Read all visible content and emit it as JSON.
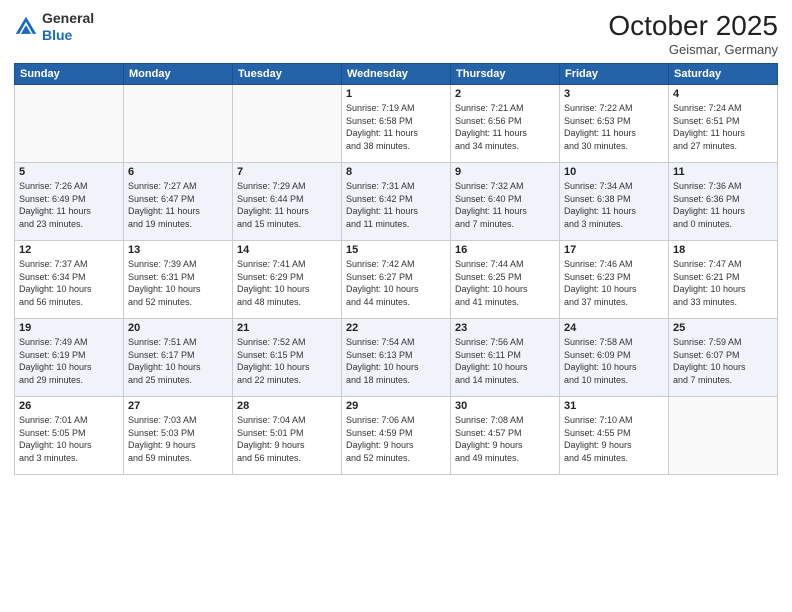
{
  "header": {
    "logo_general": "General",
    "logo_blue": "Blue",
    "month_title": "October 2025",
    "location": "Geismar, Germany"
  },
  "weekdays": [
    "Sunday",
    "Monday",
    "Tuesday",
    "Wednesday",
    "Thursday",
    "Friday",
    "Saturday"
  ],
  "weeks": [
    [
      {
        "day": "",
        "info": ""
      },
      {
        "day": "",
        "info": ""
      },
      {
        "day": "",
        "info": ""
      },
      {
        "day": "1",
        "info": "Sunrise: 7:19 AM\nSunset: 6:58 PM\nDaylight: 11 hours\nand 38 minutes."
      },
      {
        "day": "2",
        "info": "Sunrise: 7:21 AM\nSunset: 6:56 PM\nDaylight: 11 hours\nand 34 minutes."
      },
      {
        "day": "3",
        "info": "Sunrise: 7:22 AM\nSunset: 6:53 PM\nDaylight: 11 hours\nand 30 minutes."
      },
      {
        "day": "4",
        "info": "Sunrise: 7:24 AM\nSunset: 6:51 PM\nDaylight: 11 hours\nand 27 minutes."
      }
    ],
    [
      {
        "day": "5",
        "info": "Sunrise: 7:26 AM\nSunset: 6:49 PM\nDaylight: 11 hours\nand 23 minutes."
      },
      {
        "day": "6",
        "info": "Sunrise: 7:27 AM\nSunset: 6:47 PM\nDaylight: 11 hours\nand 19 minutes."
      },
      {
        "day": "7",
        "info": "Sunrise: 7:29 AM\nSunset: 6:44 PM\nDaylight: 11 hours\nand 15 minutes."
      },
      {
        "day": "8",
        "info": "Sunrise: 7:31 AM\nSunset: 6:42 PM\nDaylight: 11 hours\nand 11 minutes."
      },
      {
        "day": "9",
        "info": "Sunrise: 7:32 AM\nSunset: 6:40 PM\nDaylight: 11 hours\nand 7 minutes."
      },
      {
        "day": "10",
        "info": "Sunrise: 7:34 AM\nSunset: 6:38 PM\nDaylight: 11 hours\nand 3 minutes."
      },
      {
        "day": "11",
        "info": "Sunrise: 7:36 AM\nSunset: 6:36 PM\nDaylight: 11 hours\nand 0 minutes."
      }
    ],
    [
      {
        "day": "12",
        "info": "Sunrise: 7:37 AM\nSunset: 6:34 PM\nDaylight: 10 hours\nand 56 minutes."
      },
      {
        "day": "13",
        "info": "Sunrise: 7:39 AM\nSunset: 6:31 PM\nDaylight: 10 hours\nand 52 minutes."
      },
      {
        "day": "14",
        "info": "Sunrise: 7:41 AM\nSunset: 6:29 PM\nDaylight: 10 hours\nand 48 minutes."
      },
      {
        "day": "15",
        "info": "Sunrise: 7:42 AM\nSunset: 6:27 PM\nDaylight: 10 hours\nand 44 minutes."
      },
      {
        "day": "16",
        "info": "Sunrise: 7:44 AM\nSunset: 6:25 PM\nDaylight: 10 hours\nand 41 minutes."
      },
      {
        "day": "17",
        "info": "Sunrise: 7:46 AM\nSunset: 6:23 PM\nDaylight: 10 hours\nand 37 minutes."
      },
      {
        "day": "18",
        "info": "Sunrise: 7:47 AM\nSunset: 6:21 PM\nDaylight: 10 hours\nand 33 minutes."
      }
    ],
    [
      {
        "day": "19",
        "info": "Sunrise: 7:49 AM\nSunset: 6:19 PM\nDaylight: 10 hours\nand 29 minutes."
      },
      {
        "day": "20",
        "info": "Sunrise: 7:51 AM\nSunset: 6:17 PM\nDaylight: 10 hours\nand 25 minutes."
      },
      {
        "day": "21",
        "info": "Sunrise: 7:52 AM\nSunset: 6:15 PM\nDaylight: 10 hours\nand 22 minutes."
      },
      {
        "day": "22",
        "info": "Sunrise: 7:54 AM\nSunset: 6:13 PM\nDaylight: 10 hours\nand 18 minutes."
      },
      {
        "day": "23",
        "info": "Sunrise: 7:56 AM\nSunset: 6:11 PM\nDaylight: 10 hours\nand 14 minutes."
      },
      {
        "day": "24",
        "info": "Sunrise: 7:58 AM\nSunset: 6:09 PM\nDaylight: 10 hours\nand 10 minutes."
      },
      {
        "day": "25",
        "info": "Sunrise: 7:59 AM\nSunset: 6:07 PM\nDaylight: 10 hours\nand 7 minutes."
      }
    ],
    [
      {
        "day": "26",
        "info": "Sunrise: 7:01 AM\nSunset: 5:05 PM\nDaylight: 10 hours\nand 3 minutes."
      },
      {
        "day": "27",
        "info": "Sunrise: 7:03 AM\nSunset: 5:03 PM\nDaylight: 9 hours\nand 59 minutes."
      },
      {
        "day": "28",
        "info": "Sunrise: 7:04 AM\nSunset: 5:01 PM\nDaylight: 9 hours\nand 56 minutes."
      },
      {
        "day": "29",
        "info": "Sunrise: 7:06 AM\nSunset: 4:59 PM\nDaylight: 9 hours\nand 52 minutes."
      },
      {
        "day": "30",
        "info": "Sunrise: 7:08 AM\nSunset: 4:57 PM\nDaylight: 9 hours\nand 49 minutes."
      },
      {
        "day": "31",
        "info": "Sunrise: 7:10 AM\nSunset: 4:55 PM\nDaylight: 9 hours\nand 45 minutes."
      },
      {
        "day": "",
        "info": ""
      }
    ]
  ]
}
